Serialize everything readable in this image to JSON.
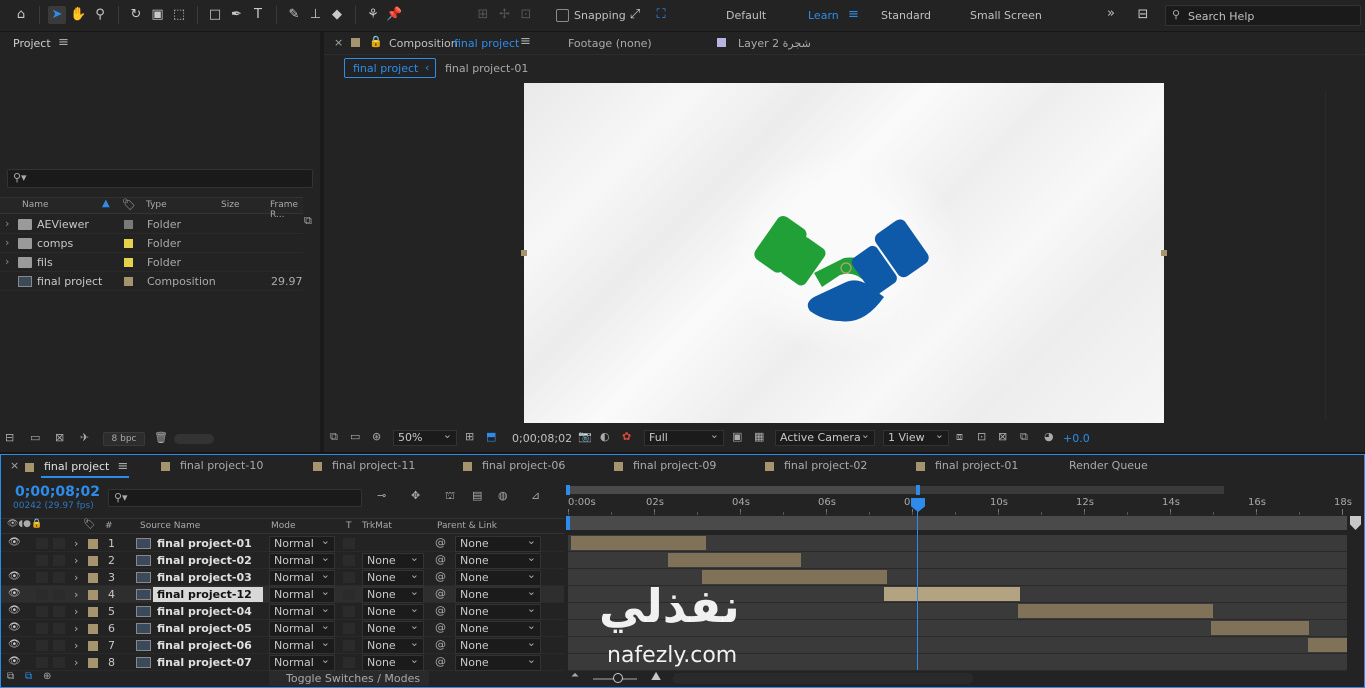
{
  "toolbar": {
    "snapping_label": "Snapping",
    "workspaces": [
      "Default",
      "Learn",
      "Standard",
      "Small Screen"
    ],
    "active_workspace": "Learn",
    "search_placeholder": "Search Help"
  },
  "project_panel": {
    "title": "Project",
    "columns": {
      "name": "Name",
      "type": "Type",
      "size": "Size",
      "frame_rate": "Frame R..."
    },
    "items": [
      {
        "name": "AEViewer",
        "type": "Folder",
        "frame_rate": "",
        "label_color": "#7a7a7a"
      },
      {
        "name": "comps",
        "type": "Folder",
        "frame_rate": "",
        "label_color": "#e6d24a"
      },
      {
        "name": "fils",
        "type": "Folder",
        "frame_rate": "",
        "label_color": "#e6d24a"
      },
      {
        "name": "final project",
        "type": "Composition",
        "frame_rate": "29.97",
        "label_color": "#a5946d"
      }
    ],
    "bpc": "8 bpc"
  },
  "comp_panel": {
    "tab_prefix": "Composition",
    "tab_name": "final project",
    "footage_tab": "Footage (none)",
    "layer_tab": "Layer 2 شجرة",
    "breadcrumbs": [
      "final project",
      "final project-01"
    ],
    "zoom": "50%",
    "timecode": "0;00;08;02",
    "resolution": "Full",
    "camera": "Active Camera",
    "views": "1 View",
    "exposure": "+0.0"
  },
  "timeline": {
    "tabs": [
      "final project",
      "final project-10",
      "final project-11",
      "final project-06",
      "final project-09",
      "final project-02",
      "final project-01",
      "Render Queue"
    ],
    "timecode": "0;00;08;02",
    "frame_info": "00242 (29.97 fps)",
    "columns": {
      "num": "#",
      "source": "Source Name",
      "mode": "Mode",
      "t": "T",
      "trkmat": "TrkMat",
      "parent": "Parent & Link"
    },
    "ruler": [
      "0:00s",
      "02s",
      "04s",
      "06s",
      "08s",
      "10s",
      "12s",
      "14s",
      "16s",
      "18s"
    ],
    "layers": [
      {
        "num": "1",
        "name": "final project-01",
        "mode": "Normal",
        "trkmat": "",
        "parent": "None"
      },
      {
        "num": "2",
        "name": "final project-02",
        "mode": "Normal",
        "trkmat": "None",
        "parent": "None"
      },
      {
        "num": "3",
        "name": "final project-03",
        "mode": "Normal",
        "trkmat": "None",
        "parent": "None"
      },
      {
        "num": "4",
        "name": "final project-12",
        "mode": "Normal",
        "trkmat": "None",
        "parent": "None"
      },
      {
        "num": "5",
        "name": "final project-04",
        "mode": "Normal",
        "trkmat": "None",
        "parent": "None"
      },
      {
        "num": "6",
        "name": "final project-05",
        "mode": "Normal",
        "trkmat": "None",
        "parent": "None"
      },
      {
        "num": "7",
        "name": "final project-06",
        "mode": "Normal",
        "trkmat": "None",
        "parent": "None"
      },
      {
        "num": "8",
        "name": "final project-07",
        "mode": "Normal",
        "trkmat": "None",
        "parent": "None"
      }
    ],
    "toggle_label": "Toggle Switches / Modes"
  },
  "watermark": {
    "arabic": "نفذلي",
    "latin": "nafezly.com"
  },
  "colors": {
    "accent": "#2d8ceb",
    "logo_green": "#22a038",
    "logo_blue": "#0e5aa8",
    "layer_bar": "#7f7259"
  }
}
